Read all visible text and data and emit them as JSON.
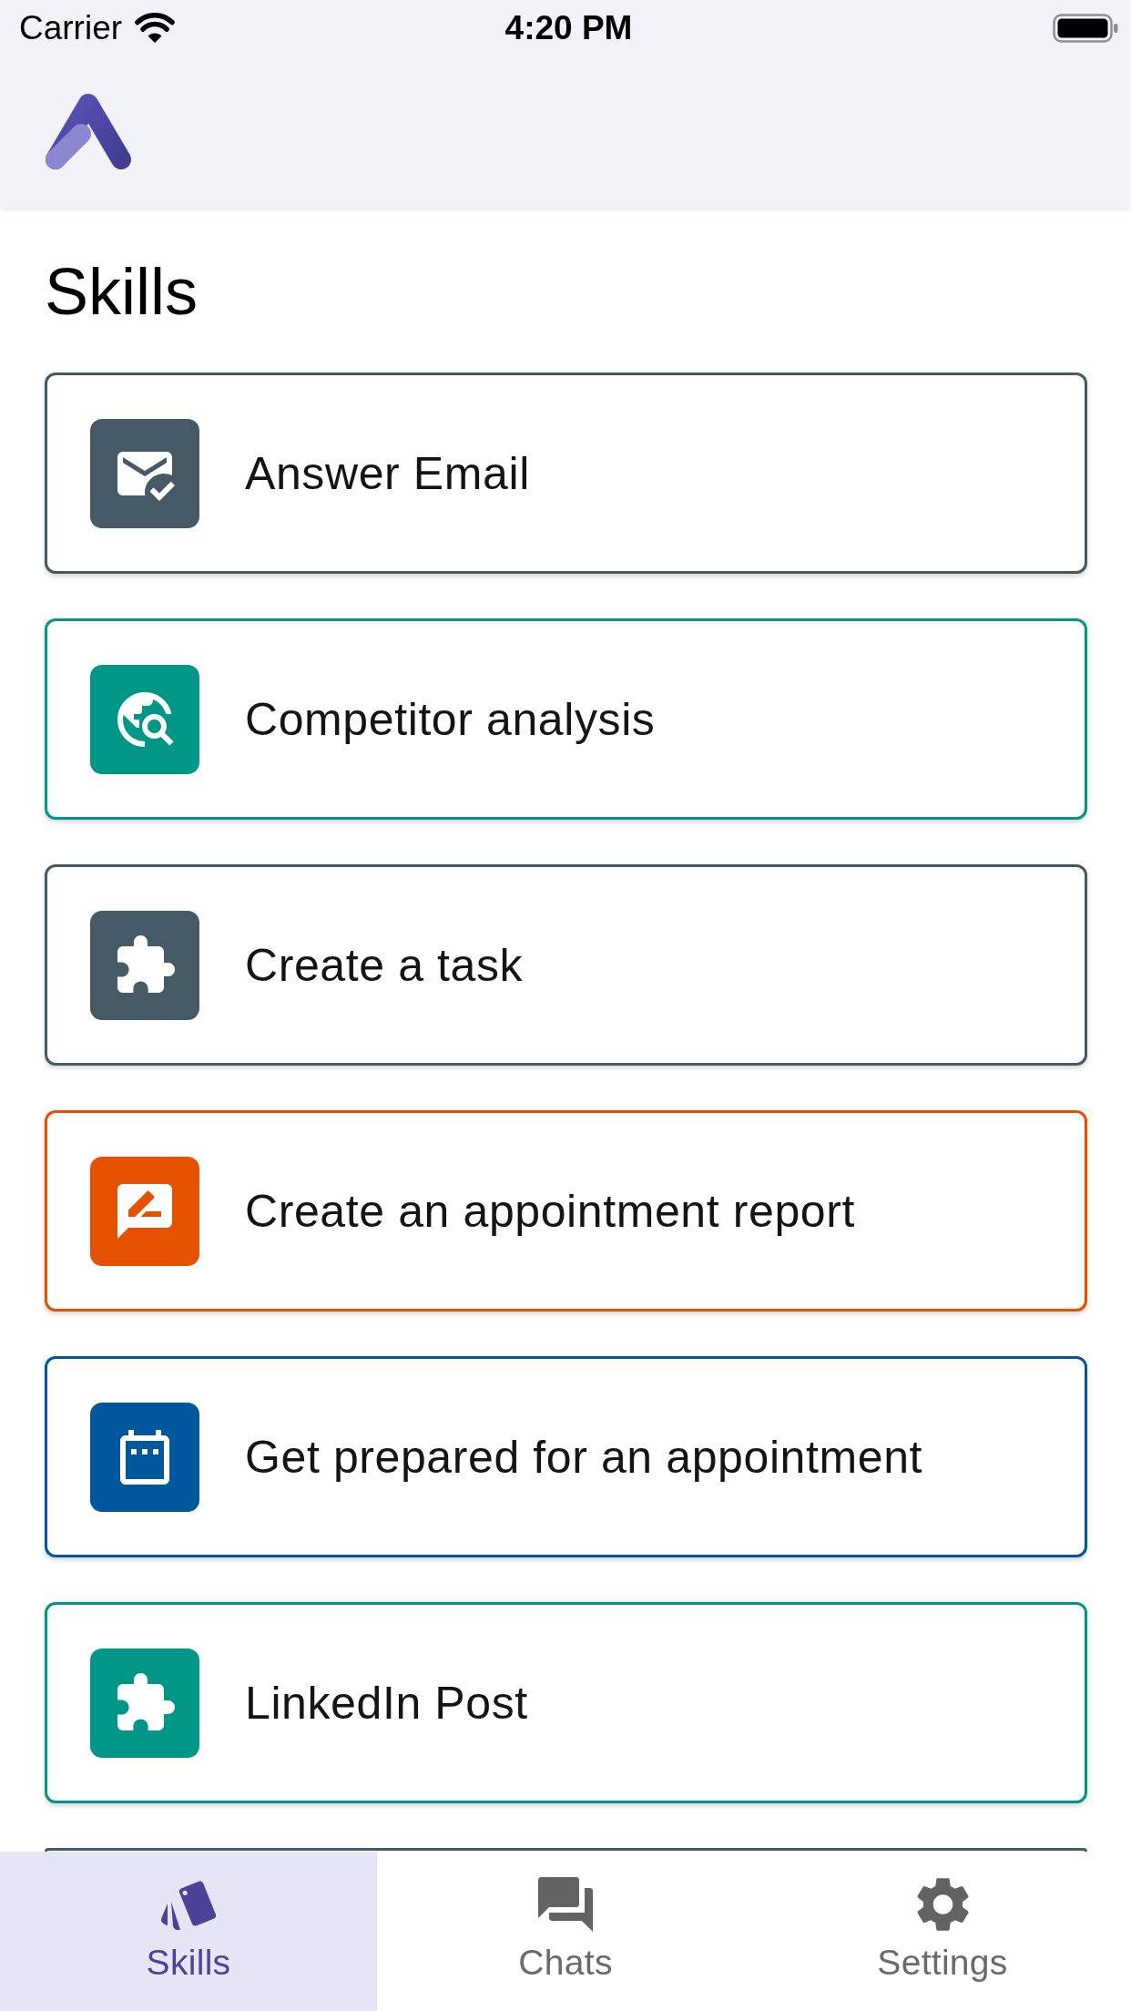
{
  "status_bar": {
    "carrier": "Carrier",
    "time": "4:20 PM"
  },
  "page_title": "Skills",
  "skills": [
    {
      "label": "Answer Email",
      "kind": "email",
      "color": "#455a64"
    },
    {
      "label": "Competitor analysis",
      "kind": "search",
      "color": "#009688"
    },
    {
      "label": "Create a task",
      "kind": "puzzle",
      "color": "#455a64"
    },
    {
      "label": "Create an appointment report",
      "kind": "report",
      "color": "#e65100"
    },
    {
      "label": "Get prepared for an appointment",
      "kind": "calendar",
      "color": "#01579b"
    },
    {
      "label": "LinkedIn Post",
      "kind": "puzzle",
      "color": "#009688"
    },
    {
      "kind": "edge",
      "color": "#455a64"
    }
  ],
  "tabs": [
    {
      "label": "Skills",
      "kind": "cards",
      "selected": true
    },
    {
      "label": "Chats",
      "kind": "chats",
      "selected": false
    },
    {
      "label": "Settings",
      "kind": "gear",
      "selected": false
    }
  ]
}
